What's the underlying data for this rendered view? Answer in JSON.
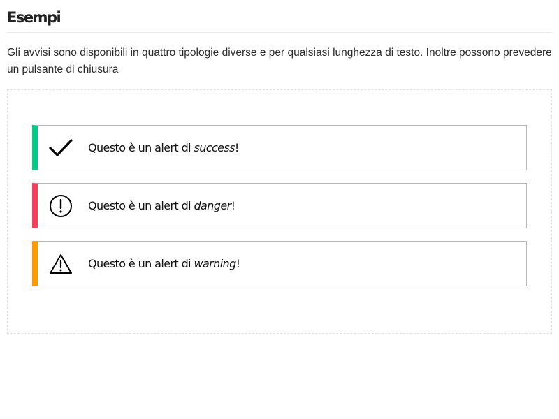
{
  "section": {
    "title": "Esempi",
    "description": "Gli avvisi sono disponibili in quattro tipologie diverse e per qualsiasi lunghezza di testo. Inoltre possono prevedere un pulsante di chiusura"
  },
  "alerts": [
    {
      "type": "success",
      "icon": "check-icon",
      "color": "#00cc85",
      "text_before": "Questo è un alert di ",
      "emphasis": "success",
      "text_after": "!"
    },
    {
      "type": "danger",
      "icon": "exclamation-circle-icon",
      "color": "#f73e5a",
      "text_before": "Questo è un alert di ",
      "emphasis": "danger",
      "text_after": "!"
    },
    {
      "type": "warning",
      "icon": "warning-triangle-icon",
      "color": "#ff9900",
      "text_before": "Questo è un alert di ",
      "emphasis": "warning",
      "text_after": "!"
    }
  ]
}
